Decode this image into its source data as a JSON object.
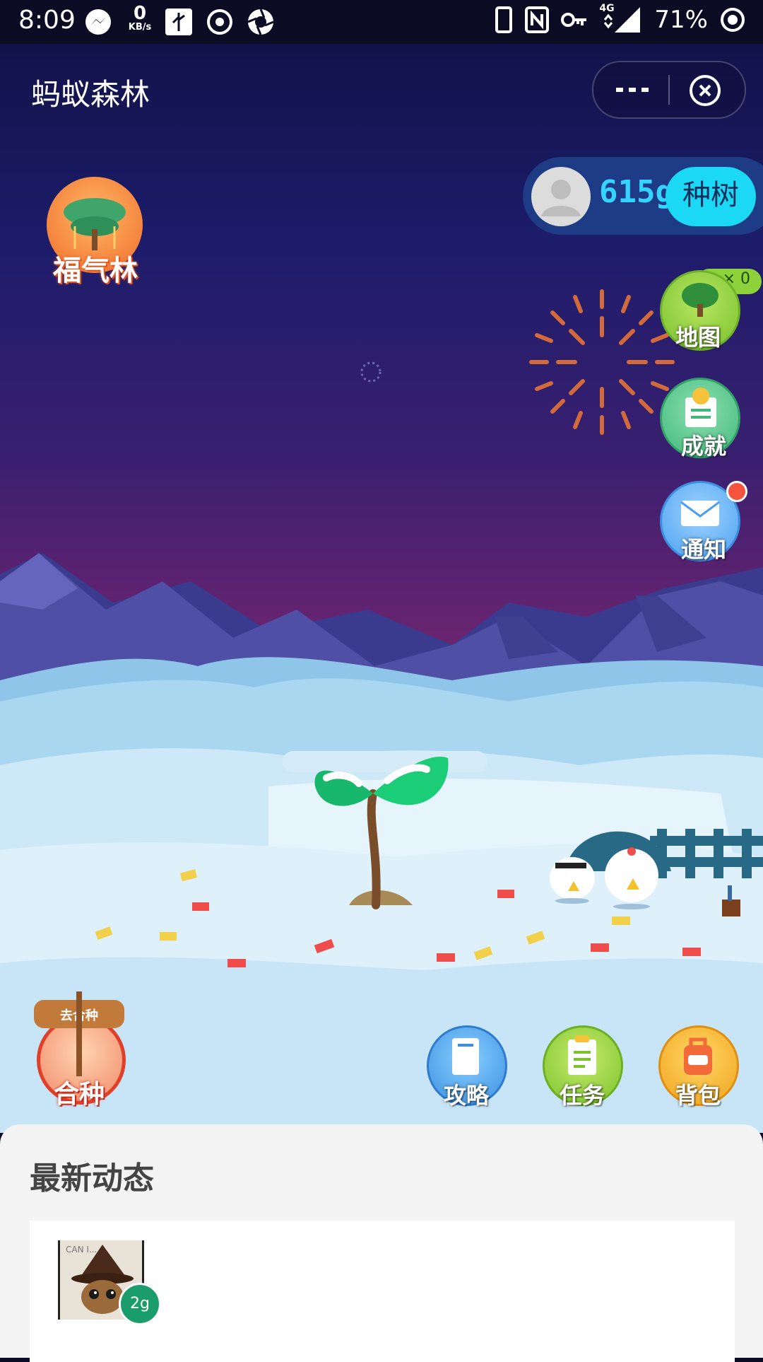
{
  "status_bar": {
    "time": "8:09",
    "net_speed_value": "0",
    "net_speed_unit": "KB/s",
    "network": "4G",
    "battery": "71%"
  },
  "nav": {
    "title": "蚂蚁森林"
  },
  "energy": {
    "amount": "615g",
    "plant_label": "种树"
  },
  "left_buttons": {
    "blessing_forest": "福气林",
    "co_plant": "合种",
    "co_plant_sign": "去合种"
  },
  "right_buttons": {
    "map": "地图",
    "map_badge": "× 0",
    "achievement": "成就",
    "notice": "通知"
  },
  "bottom_buttons": {
    "guide": "攻略",
    "task": "任务",
    "backpack": "背包"
  },
  "feed": {
    "title": "最新动态",
    "items": [
      {
        "avatar_caption": "CAN I...",
        "energy_badge": "2g"
      }
    ]
  },
  "colors": {
    "accent": "#1bd8f4",
    "energy_text": "#35d4ff",
    "feed_bg": "#f4f4f4"
  }
}
